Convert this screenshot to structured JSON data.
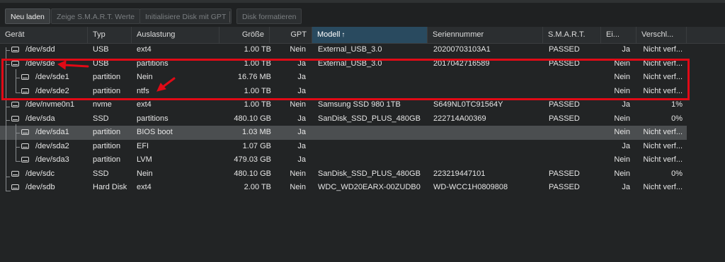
{
  "toolbar": {
    "reload": "Neu laden",
    "smart": "Zeige S.M.A.R.T. Werte",
    "init_gpt": "Initialisiere Disk mit GPT",
    "format": "Disk formatieren"
  },
  "columns": {
    "device": "Gerät",
    "type": "Typ",
    "usage": "Auslastung",
    "size": "Größe",
    "gpt": "GPT",
    "model": "Modell",
    "sort_arrow": "↑",
    "serial": "Seriennummer",
    "smart": "S.M.A.R.T.",
    "ei": "Ei...",
    "wear": "Verschl..."
  },
  "rows": [
    {
      "device": "/dev/sdd",
      "type": "USB",
      "usage": "ext4",
      "size": "1.00 TB",
      "gpt": "Nein",
      "model": "External_USB_3.0",
      "serial": "20200703103A1",
      "smart": "PASSED",
      "ei": "Ja",
      "wear": "Nicht verf..."
    },
    {
      "device": "/dev/sde",
      "type": "USB",
      "usage": "partitions",
      "size": "1.00 TB",
      "gpt": "Ja",
      "model": "External_USB_3.0",
      "serial": "2017042716589",
      "smart": "PASSED",
      "ei": "Nein",
      "wear": "Nicht verf..."
    },
    {
      "device": "/dev/sde1",
      "type": "partition",
      "usage": "Nein",
      "size": "16.76 MB",
      "gpt": "Ja",
      "model": "",
      "serial": "",
      "smart": "",
      "ei": "Nein",
      "wear": "Nicht verf..."
    },
    {
      "device": "/dev/sde2",
      "type": "partition",
      "usage": "ntfs",
      "size": "1.00 TB",
      "gpt": "Ja",
      "model": "",
      "serial": "",
      "smart": "",
      "ei": "Nein",
      "wear": "Nicht verf..."
    },
    {
      "device": "/dev/nvme0n1",
      "type": "nvme",
      "usage": "ext4",
      "size": "1.00 TB",
      "gpt": "Nein",
      "model": "Samsung SSD 980 1TB",
      "serial": "S649NL0TC91564Y",
      "smart": "PASSED",
      "ei": "Ja",
      "wear": "1%"
    },
    {
      "device": "/dev/sda",
      "type": "SSD",
      "usage": "partitions",
      "size": "480.10 GB",
      "gpt": "Ja",
      "model": "SanDisk_SSD_PLUS_480GB",
      "serial": "222714A00369",
      "smart": "PASSED",
      "ei": "Nein",
      "wear": "0%"
    },
    {
      "device": "/dev/sda1",
      "type": "partition",
      "usage": "BIOS boot",
      "size": "1.03 MB",
      "gpt": "Ja",
      "model": "",
      "serial": "",
      "smart": "",
      "ei": "Nein",
      "wear": "Nicht verf..."
    },
    {
      "device": "/dev/sda2",
      "type": "partition",
      "usage": "EFI",
      "size": "1.07 GB",
      "gpt": "Ja",
      "model": "",
      "serial": "",
      "smart": "",
      "ei": "Ja",
      "wear": "Nicht verf..."
    },
    {
      "device": "/dev/sda3",
      "type": "partition",
      "usage": "LVM",
      "size": "479.03 GB",
      "gpt": "Ja",
      "model": "",
      "serial": "",
      "smart": "",
      "ei": "Nein",
      "wear": "Nicht verf..."
    },
    {
      "device": "/dev/sdc",
      "type": "SSD",
      "usage": "Nein",
      "size": "480.10 GB",
      "gpt": "Nein",
      "model": "SanDisk_SSD_PLUS_480GB",
      "serial": "223219447101",
      "smart": "PASSED",
      "ei": "Nein",
      "wear": "0%"
    },
    {
      "device": "/dev/sdb",
      "type": "Hard Disk",
      "usage": "ext4",
      "size": "2.00 TB",
      "gpt": "Nein",
      "model": "WDC_WD20EARX-00ZUDB0",
      "serial": "WD-WCC1H0809808",
      "smart": "PASSED",
      "ei": "Ja",
      "wear": "Nicht verf..."
    }
  ],
  "selected_row": "/dev/sda1",
  "annotation_color": "#e10a16"
}
